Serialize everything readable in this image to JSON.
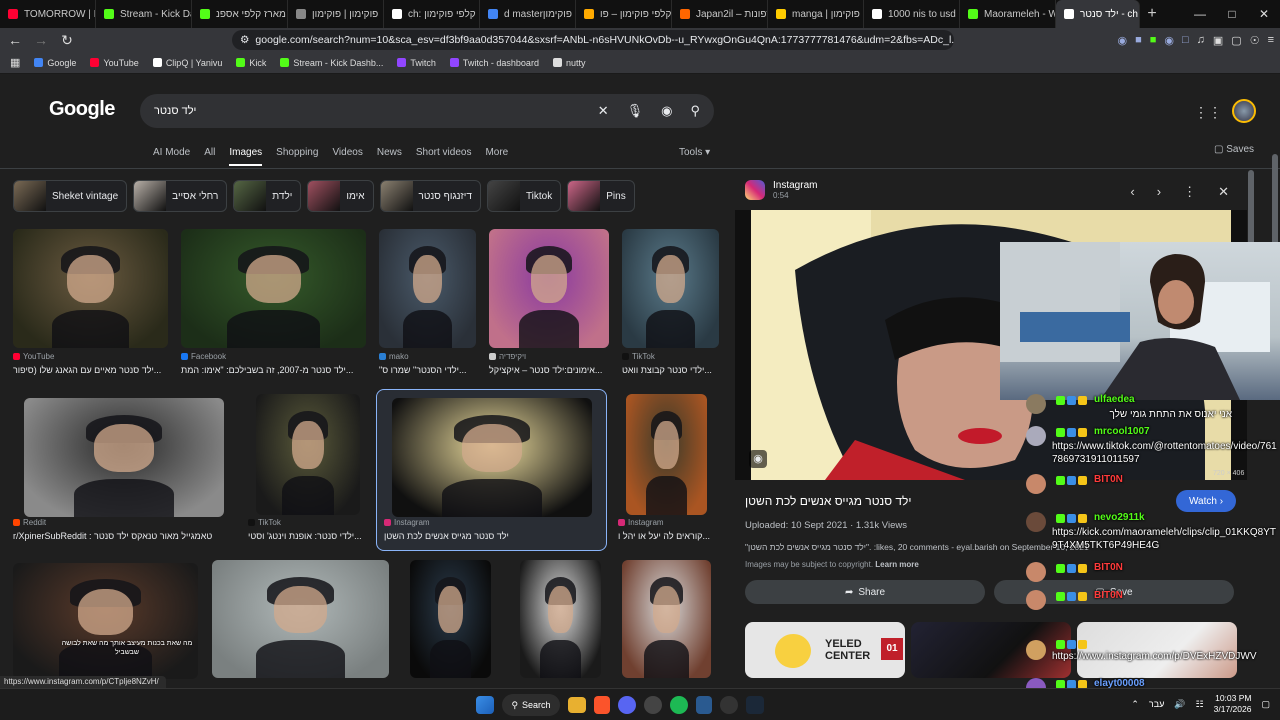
{
  "tabs": [
    {
      "title": "TOMORROW | In",
      "color": "#ff0033"
    },
    {
      "title": "Stream - Kick Da",
      "color": "#53fc18"
    },
    {
      "title": "מארז קלפי אספנ",
      "color": "#53fc18"
    },
    {
      "title": "פוקימון | פוקימון",
      "color": "#888888"
    },
    {
      "title": "ch: קלפי פוקימון",
      "color": "#ffffff"
    },
    {
      "title": "d masterן | פוקימון",
      "color": "#4285f4"
    },
    {
      "title": "קלפי פוקימון – פו",
      "color": "#ffaa00"
    },
    {
      "title": "Japan2il – ספונות",
      "color": "#ff6600"
    },
    {
      "title": "manga | פוקימון",
      "color": "#ffcc00"
    },
    {
      "title": "1000 nis to usd -",
      "color": "#ffffff"
    },
    {
      "title": "Maorameleh - W",
      "color": "#53fc18"
    },
    {
      "title": "ילד סנטר - ch",
      "color": "#ffffff",
      "active": true
    }
  ],
  "url": "google.com/search?num=10&sca_esv=df3bf9aa0d357044&sxsrf=ANbL-n6sHVUNkOvDb--u_RYwxgOnGu4QnA:1773777781476&udm=2&fbs=ADc_l...",
  "bookmarks": [
    {
      "label": "Google",
      "color": "#4285f4"
    },
    {
      "label": "YouTube",
      "color": "#ff0033"
    },
    {
      "label": "ClipQ | Yanivu",
      "color": "#ffffff"
    },
    {
      "label": "Kick",
      "color": "#53fc18"
    },
    {
      "label": "Stream - Kick Dashb...",
      "color": "#53fc18"
    },
    {
      "label": "Twitch",
      "color": "#9146ff"
    },
    {
      "label": "Twitch - dashboard",
      "color": "#9146ff"
    },
    {
      "label": "nutty",
      "color": "#dddddd"
    }
  ],
  "google": {
    "logo": "Google",
    "query": "ילד סנטר",
    "filters": [
      "AI Mode",
      "All",
      "Images",
      "Shopping",
      "Videos",
      "News",
      "Short videos",
      "More"
    ],
    "active_filter": "Images",
    "tools": "Tools",
    "saves": "Saves"
  },
  "chips": [
    {
      "label": "Sheket vintage",
      "color": "#7a6a55"
    },
    {
      "label": "רחלי אסייב",
      "color": "#b8b0a8"
    },
    {
      "label": "ילדת",
      "color": "#556644"
    },
    {
      "label": "אימו",
      "color": "#a05060"
    },
    {
      "label": "דיזנגוף סנטר",
      "color": "#8a8070"
    },
    {
      "label": "Tiktok",
      "color": "#444444"
    },
    {
      "label": "Pins",
      "color": "#cc6688"
    }
  ],
  "results": [
    {
      "source": "YouTube",
      "caption": "ילד סנטר מאיים עם הגאנג שלו (סיפור...",
      "src_color": "#ff0033",
      "c1": "#6a5a40",
      "c2": "#2a2a1a"
    },
    {
      "source": "Facebook",
      "caption": "ילד סנטר מ-2007, זה בשבילכם: \"אימו: המת...",
      "src_color": "#1877f2",
      "c1": "#355a2a",
      "c2": "#1c2e18"
    },
    {
      "source": "mako",
      "caption": "\"ילדי הסנטר\" שמרו ס...",
      "src_color": "#2a7fd4",
      "c1": "#4a5a6a",
      "c2": "#2a3038"
    },
    {
      "source": "ויקיפדיה",
      "caption": "אימונים:ילד סנטר – איקציקל...",
      "src_color": "#cccccc",
      "c1": "#8a3aa0",
      "c2": "#c0708a"
    },
    {
      "source": "TikTok",
      "caption": "ילדי סנטר קבוצת וואט...",
      "src_color": "#111111",
      "c1": "#5a7a8a",
      "c2": "#2a3a44"
    },
    {
      "source": "Reddit",
      "caption": "r/XpinerSubReddit : טאמגייל מאור טנאקס ילד סנטר",
      "src_color": "#ff4500",
      "c1": "#2a2a2a",
      "c2": "#8a8a8a"
    },
    {
      "source": "TikTok",
      "caption": "ילדי סנטר: אופנת וינטג' וסטי...",
      "src_color": "#111111",
      "c1": "#5a5a3a",
      "c2": "#1a1a1a"
    },
    {
      "source": "Instagram",
      "caption": "ילד סנטר מגייס אנשים לכת השטן",
      "src_color": "#d62976",
      "c1": "#f0e0a0",
      "c2": "#101010"
    },
    {
      "source": "Instagram",
      "caption": "קוראים לה יעל או יהל ו...",
      "src_color": "#d62976",
      "c1": "#3a3a2a",
      "c2": "#aa5522"
    },
    {
      "caption": "",
      "source": "",
      "c1": "#5a3a2a",
      "c2": "#1a1a1a"
    },
    {
      "caption": "",
      "source": "",
      "c1": "#b0b8b8",
      "c2": "#7a8080"
    },
    {
      "caption": "",
      "source": "",
      "c1": "#2a3a4a",
      "c2": "#0a0a0a"
    },
    {
      "caption": "",
      "source": "",
      "c1": "#e0e0e0",
      "c2": "#1a1a1a"
    },
    {
      "caption": "",
      "source": "",
      "c1": "#d8d8d8",
      "c2": "#704030"
    }
  ],
  "webcam_overlay_text": "מה שאת בכנות מעיצב אותך מה שאת לבושה שבשביל",
  "panel": {
    "source": "Instagram",
    "duration": "0:54",
    "dims": "720 × 406",
    "title": "ילד סנטר מגייס אנשים לכת השטן",
    "watch": "Watch",
    "uploaded": "Uploaded: 10 Sept 2021 · 1.31k Views",
    "desc": "\"ילד סנטר מגייס אנשים לכת השטן\". :likes, 20 comments - eyal.barish on September 10, 2021",
    "copyright": "Images may be subject to copyright.",
    "learn_more": "Learn more",
    "share": "Share",
    "save": "Save",
    "thumb_labels": [
      "YELED",
      "CENTER",
      "01"
    ]
  },
  "chat": [
    {
      "name": "ulfaedea",
      "text": "אני יאנוס את התחת גומי שלך",
      "color": "#53fc18"
    },
    {
      "name": "mrcool1007",
      "text": "https://www.tiktok.com/@rottentomatoes/video/7617869731911011597",
      "color": "#53fc18"
    },
    {
      "name": "BIT0N",
      "text": "",
      "color": "#ff3b3b"
    },
    {
      "name": "nevo2911k",
      "text": "https://kick.com/maorameleh/clips/clip_01KKQ8YT9T4XM5TKT6P49HE4G",
      "color": "#53fc18"
    },
    {
      "name": "BIT0N",
      "text": "",
      "color": "#ff3b3b"
    },
    {
      "name": "BIT0N",
      "text": "",
      "color": "#ff3b3b"
    },
    {
      "name": "",
      "text": "https://www.instagram.com/p/DVExHZVDJWV",
      "color": "#53fc18"
    },
    {
      "name": "elayt00008",
      "text": "",
      "color": "#6aa0ff"
    }
  ],
  "status_url": "https://www.instagram.com/p/CTplje8NZvH/",
  "taskbar": {
    "search": "Search",
    "lang": "עבר",
    "time": "10:03 PM",
    "date": "3/17/2026"
  }
}
